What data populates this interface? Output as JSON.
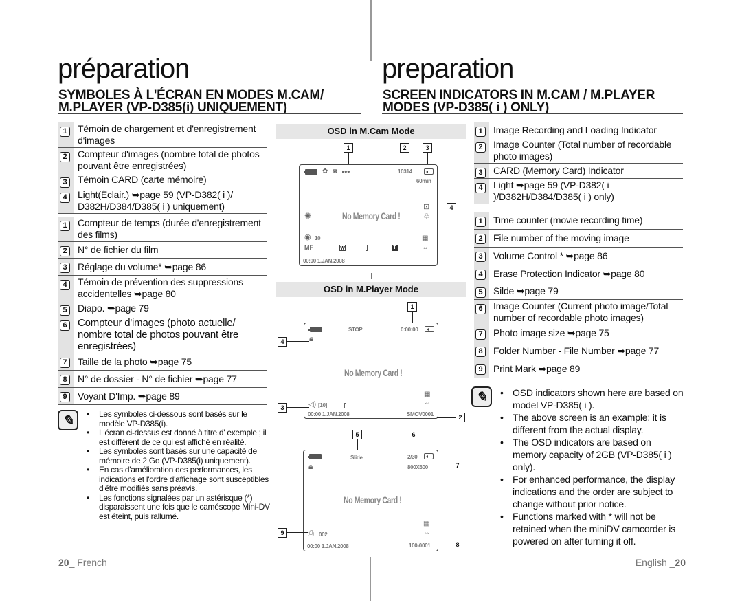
{
  "french": {
    "page_title": "préparation",
    "section_title_line1": "SYMBOLES À L'ÉCRAN EN MODES M.CAM/",
    "section_title_line2": "M.PLAYER (VP-D385(i) UNIQUEMENT)",
    "mcam_items": [
      {
        "num": "1",
        "text": "Témoin de chargement et d'enregistrement d'images"
      },
      {
        "num": "2",
        "text": "Compteur d'images (nombre total de photos pouvant être enregistrées)"
      },
      {
        "num": "3",
        "text": "Témoin CARD (carte mémoire)"
      },
      {
        "num": "4",
        "text": "Light(Éclair.) ➥page 59 (VP-D382( i )/ D382H/D384/D385( i ) uniquement)"
      }
    ],
    "mplayer_items": [
      {
        "num": "1",
        "text": "Compteur de temps (durée d'enregistrement des films)"
      },
      {
        "num": "2",
        "text": "N° de fichier du film"
      },
      {
        "num": "3",
        "text": "Réglage du volume* ➥page 86"
      },
      {
        "num": "4",
        "text": "Témoin de prévention des suppressions accidentelles ➥page 80"
      },
      {
        "num": "5",
        "text": "Diapo. ➥page 79"
      },
      {
        "num": "6",
        "text": "Compteur d'images (photo actuelle/ nombre total de photos pouvant être enregistrées)"
      },
      {
        "num": "7",
        "text": "Taille de la photo ➥page 75"
      },
      {
        "num": "8",
        "text": "N° de dossier - N° de fichier ➥page 77"
      },
      {
        "num": "9",
        "text": "Voyant D'Imp. ➥page 89"
      }
    ],
    "notes": [
      "Les symboles ci-dessous sont basés sur le modèle VP-D385(i).",
      "L'écran ci-dessus est donné à titre d' exemple ; il est différent de ce qui est affiché en réalité.",
      "Les symboles sont basés sur une capacité de mémoire de 2 Go (VP-D385(i) uniquement).",
      "En cas d'amélioration des performances, les indications et l'ordre d'affichage sont susceptibles d'être modifiés sans préavis.",
      "Les fonctions signalées par un astérisque (*) disparaissent une fois que le caméscope Mini-DV est éteint, puis rallumé."
    ],
    "footer_page": "20",
    "footer_lang": "_ French"
  },
  "english": {
    "page_title": "preparation",
    "section_title_line1": "SCREEN INDICATORS IN M.CAM / M.PLAYER",
    "section_title_line2": "MODES (VP-D385( i ) ONLY)",
    "mcam_items": [
      {
        "num": "1",
        "text": "Image Recording and Loading Indicator"
      },
      {
        "num": "2",
        "text": "Image Counter (Total number of recordable photo images)"
      },
      {
        "num": "3",
        "text": "CARD (Memory Card) Indicator"
      },
      {
        "num": "4",
        "text": "Light ➥page 59 (VP-D382( i )/D382H/D384/D385( i ) only)"
      }
    ],
    "mplayer_items": [
      {
        "num": "1",
        "text": "Time counter (movie recording time)"
      },
      {
        "num": "2",
        "text": "File number of the moving image"
      },
      {
        "num": "3",
        "text": "Volume Control * ➥page 86"
      },
      {
        "num": "4",
        "text": " Erase Protection Indicator ➥page 80"
      },
      {
        "num": "5",
        "text": "Silde ➥page 79"
      },
      {
        "num": "6",
        "text": "Image Counter (Current photo image/Total number of recordable photo images)"
      },
      {
        "num": "7",
        "text": "Photo image size ➥page 75"
      },
      {
        "num": "8",
        "text": "Folder Number - File Number  ➥page 77"
      },
      {
        "num": "9",
        "text": "Print Mark ➥page 89"
      }
    ],
    "notes": [
      "OSD indicators shown here are based on model VP-D385( i ).",
      "The above screen is an example; it is different from the actual display.",
      "The OSD indicators are based on memory capacity of 2GB (VP-D385( i ) only).",
      "For enhanced performance, the display indications and the order are subject to change without prior notice.",
      "Functions marked with * will not be retained when the miniDV camcorder is powered on after turning it off."
    ],
    "footer_lang": "English _",
    "footer_page": "20"
  },
  "osd": {
    "mcam": {
      "header": "OSD in M.Cam Mode",
      "counter": "10314",
      "remaining": "60min",
      "message": "No Memory Card !",
      "iso": "10",
      "zoom_w": "W",
      "zoom_t": "T",
      "datetime": "00:00  1.JAN.2008",
      "callouts": [
        "1",
        "2",
        "3",
        "4"
      ],
      "icons": [
        "battery-icon",
        "macro-icon",
        "camera-icon",
        "arrows-icon",
        "card-icon",
        "light-icon",
        "stabilizer-icon",
        "face-icon",
        "whitebalance-icon",
        "manualfocus-icon",
        "grid-icon",
        "usb-icon"
      ]
    },
    "mplayer_movie": {
      "header": "OSD in M.Player Mode",
      "status": "STOP",
      "time": "0:00:00",
      "message": "No Memory Card !",
      "volume": "[10]",
      "datetime": "00:00  1.JAN.2008",
      "file": "SMOV0001",
      "callouts": [
        "1",
        "2",
        "3",
        "4"
      ]
    },
    "mplayer_photo": {
      "status": "Slide",
      "counter": "2/30",
      "size": "800X600",
      "message": "No Memory Card !",
      "print_count": "002",
      "datetime": "00:00  1.JAN.2008",
      "file": "100-0001",
      "callouts": [
        "5",
        "6",
        "7",
        "8",
        "9"
      ]
    }
  }
}
